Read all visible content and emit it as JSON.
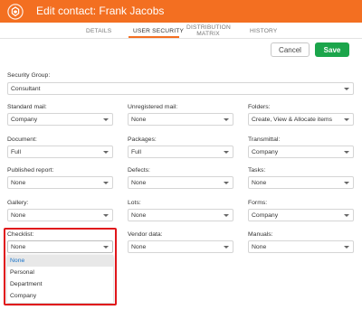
{
  "header": {
    "title": "Edit contact: Frank Jacobs",
    "logo": "shield-logo-icon",
    "brand_color": "#f36f21"
  },
  "tabs": [
    {
      "label": "DETAILS"
    },
    {
      "label": "USER SECURITY",
      "active": true
    },
    {
      "label_line1": "DISTRIBUTION",
      "label_line2": "MATRIX"
    },
    {
      "label": "HISTORY"
    }
  ],
  "actions": {
    "cancel_label": "Cancel",
    "save_label": "Save",
    "save_color": "#1ba54b"
  },
  "form": {
    "security_group": {
      "label": "Security Group:",
      "value": "Consultant"
    },
    "fields": [
      {
        "label": "Standard mail:",
        "value": "Company"
      },
      {
        "label": "Unregistered mail:",
        "value": "None"
      },
      {
        "label": "Folders:",
        "value": "Create, View & Allocate items"
      },
      {
        "label": "Document:",
        "value": "Full"
      },
      {
        "label": "Packages:",
        "value": "Full"
      },
      {
        "label": "Transmittal:",
        "value": "Company"
      },
      {
        "label": "Published report:",
        "value": "None"
      },
      {
        "label": "Defects:",
        "value": "None"
      },
      {
        "label": "Tasks:",
        "value": "None"
      },
      {
        "label": "Gallery:",
        "value": "None"
      },
      {
        "label": "Lots:",
        "value": "None"
      },
      {
        "label": "Forms:",
        "value": "Company"
      },
      {
        "label": "Checklist:",
        "value": "None"
      },
      {
        "label": "Vendor data:",
        "value": "None"
      },
      {
        "label": "Manuals:",
        "value": "None"
      }
    ]
  },
  "checklist_dropdown": {
    "options": [
      "None",
      "Personal",
      "Department",
      "Company"
    ],
    "selected": "None",
    "highlight_color": "#e0161b"
  }
}
